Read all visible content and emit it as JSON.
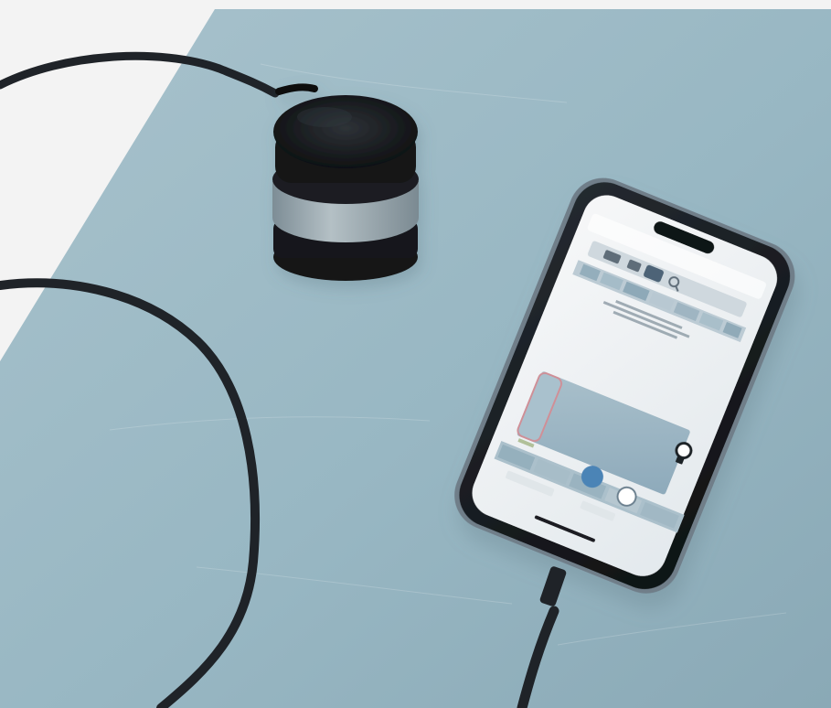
{
  "image": {
    "type": "product-photo",
    "subject": "colorimeter-and-smartphone"
  },
  "ui": {
    "phone_title": "",
    "bottom_tabs": [
      "",
      ""
    ],
    "tool_icons": [
      "camera-icon",
      "grid-icon",
      "search-icon",
      "light-bulb-icon"
    ],
    "accent": "#7a96a9"
  },
  "colors": {
    "mat": "#98b7c3",
    "mat_dark": "#88a8b6",
    "cable": "#1f2328",
    "puck_black": "#171a1d",
    "puck_band": "#9aa8b0",
    "phone_body": "#111315",
    "phone_screen_bg": "#e9edf0",
    "swatch_blue": "#9db7c4",
    "swatch_edge": "#cf8f97",
    "phone_button": "#4b84b6"
  }
}
